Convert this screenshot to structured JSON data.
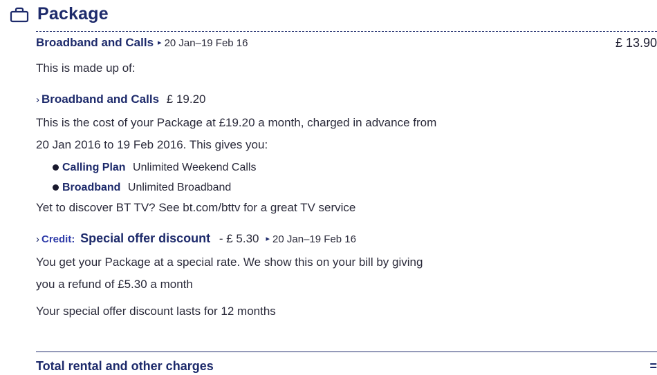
{
  "section": {
    "title": "Package",
    "icon": "package-icon"
  },
  "package": {
    "name": "Broadband and Calls",
    "period": "20 Jan–19 Feb 16",
    "amount": "£ 13.90",
    "made_up_of": "This is made up of:"
  },
  "item1": {
    "title": "Broadband and Calls",
    "amount": "£ 19.20",
    "desc_line1": "This is the cost of your Package at £19.20 a month, charged in advance from",
    "desc_line2": "20 Jan 2016 to 19 Feb 2016. This gives you:",
    "bullets": [
      {
        "label": "Calling Plan",
        "value": "Unlimited Weekend Calls"
      },
      {
        "label": "Broadband",
        "value": "Unlimited Broadband"
      }
    ],
    "promo": "Yet to discover BT TV? See bt.com/bttv for a great TV service"
  },
  "item2": {
    "credit_label": "Credit:",
    "title": "Special offer discount",
    "amount": "- £ 5.30",
    "period": "20 Jan–19 Feb 16",
    "desc_line1": "You get your Package at a special rate. We show this on your bill by giving",
    "desc_line2": "you a refund of £5.30 a month",
    "note": "Your special offer discount lasts for 12 months"
  },
  "total": {
    "label": "Total rental and other charges",
    "symbol": "="
  }
}
